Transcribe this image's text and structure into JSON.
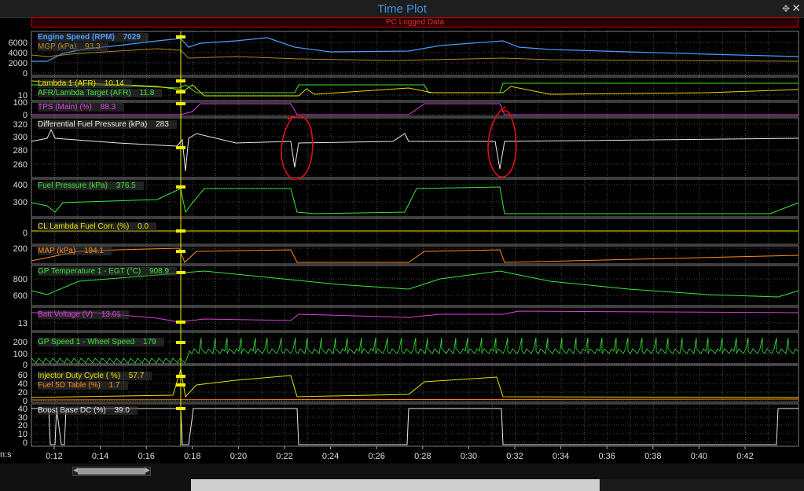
{
  "window": {
    "title": "Time Plot",
    "banner": "PC Logged Data",
    "time_unit": "n:s"
  },
  "time_axis": [
    "0:12",
    "0:14",
    "0:16",
    "0:18",
    "0:20",
    "0:22",
    "0:24",
    "0:26",
    "0:28",
    "0:30",
    "0:32",
    "0:34",
    "0:36",
    "0:38",
    "0:40",
    "0:42"
  ],
  "panels": [
    {
      "ticks": [
        "6000",
        "4000",
        "2000",
        "0"
      ],
      "labels": [
        {
          "name": "Engine Speed (RPM)",
          "value": "7029",
          "color": "#4a9cff",
          "bold": true
        },
        {
          "name": "MGP (kPa)",
          "value": "93.3",
          "color": "#b08a2a"
        }
      ]
    },
    {
      "ticks": [
        "10"
      ],
      "labels": [
        {
          "name": "Lambda 1 (AFR)",
          "value": "10.14",
          "color": "#e6e000"
        },
        {
          "name": "AFR/Lambda Target (AFR)",
          "value": "11.8",
          "color": "#39e639"
        }
      ]
    },
    {
      "ticks": [
        "100",
        "0"
      ],
      "labels": [
        {
          "name": "TPS (Main) (%)",
          "value": "88.3",
          "color": "#e040e0"
        }
      ]
    },
    {
      "ticks": [
        "320",
        "300",
        "280",
        "260"
      ],
      "labels": [
        {
          "name": "Differential Fuel Pressure (kPa)",
          "value": "283",
          "color": "#e8e8e8"
        }
      ]
    },
    {
      "ticks": [
        "400",
        "300"
      ],
      "labels": [
        {
          "name": "Fuel Pressure (kPa)",
          "value": "376.5",
          "color": "#39e639"
        }
      ]
    },
    {
      "ticks": [
        "0"
      ],
      "labels": [
        {
          "name": "CL Lambda  Fuel  Corr. (%)",
          "value": "0.0",
          "color": "#e6e000"
        }
      ]
    },
    {
      "ticks": [
        "200"
      ],
      "labels": [
        {
          "name": "MAP (kPa)",
          "value": "194.1",
          "color": "#ff8c1a"
        }
      ]
    },
    {
      "ticks": [
        "800",
        "600"
      ],
      "labels": [
        {
          "name": "GP Temperature 1 - EGT (°C)",
          "value": "908.9",
          "color": "#39e639"
        }
      ]
    },
    {
      "ticks": [
        "13"
      ],
      "labels": [
        {
          "name": "Batt Voltage (V)",
          "value": "13.01",
          "color": "#e040e0"
        }
      ]
    },
    {
      "ticks": [
        "200",
        "100",
        "0"
      ],
      "labels": [
        {
          "name": "GP Speed 1 - Wheel Speed",
          "value": "179",
          "color": "#39e639"
        }
      ]
    },
    {
      "ticks": [
        "60",
        "40",
        "20",
        "0"
      ],
      "labels": [
        {
          "name": "Injector Duty Cycle ( %)",
          "value": "57.7",
          "color": "#e6e000"
        },
        {
          "name": "Fuel 5D Table (%)",
          "value": "1.7",
          "color": "#ff8c1a"
        }
      ]
    },
    {
      "ticks": [
        "40",
        "30",
        "20",
        "10",
        "0"
      ],
      "labels": [
        {
          "name": "Boost Base DC (%)",
          "value": "39.0",
          "color": "#e8e8e8"
        }
      ]
    }
  ],
  "colors": {
    "grid": "#5a5a5a",
    "cursor": "#f0f000",
    "annotation": "#e01010",
    "frame": "#9a9a9a"
  }
}
